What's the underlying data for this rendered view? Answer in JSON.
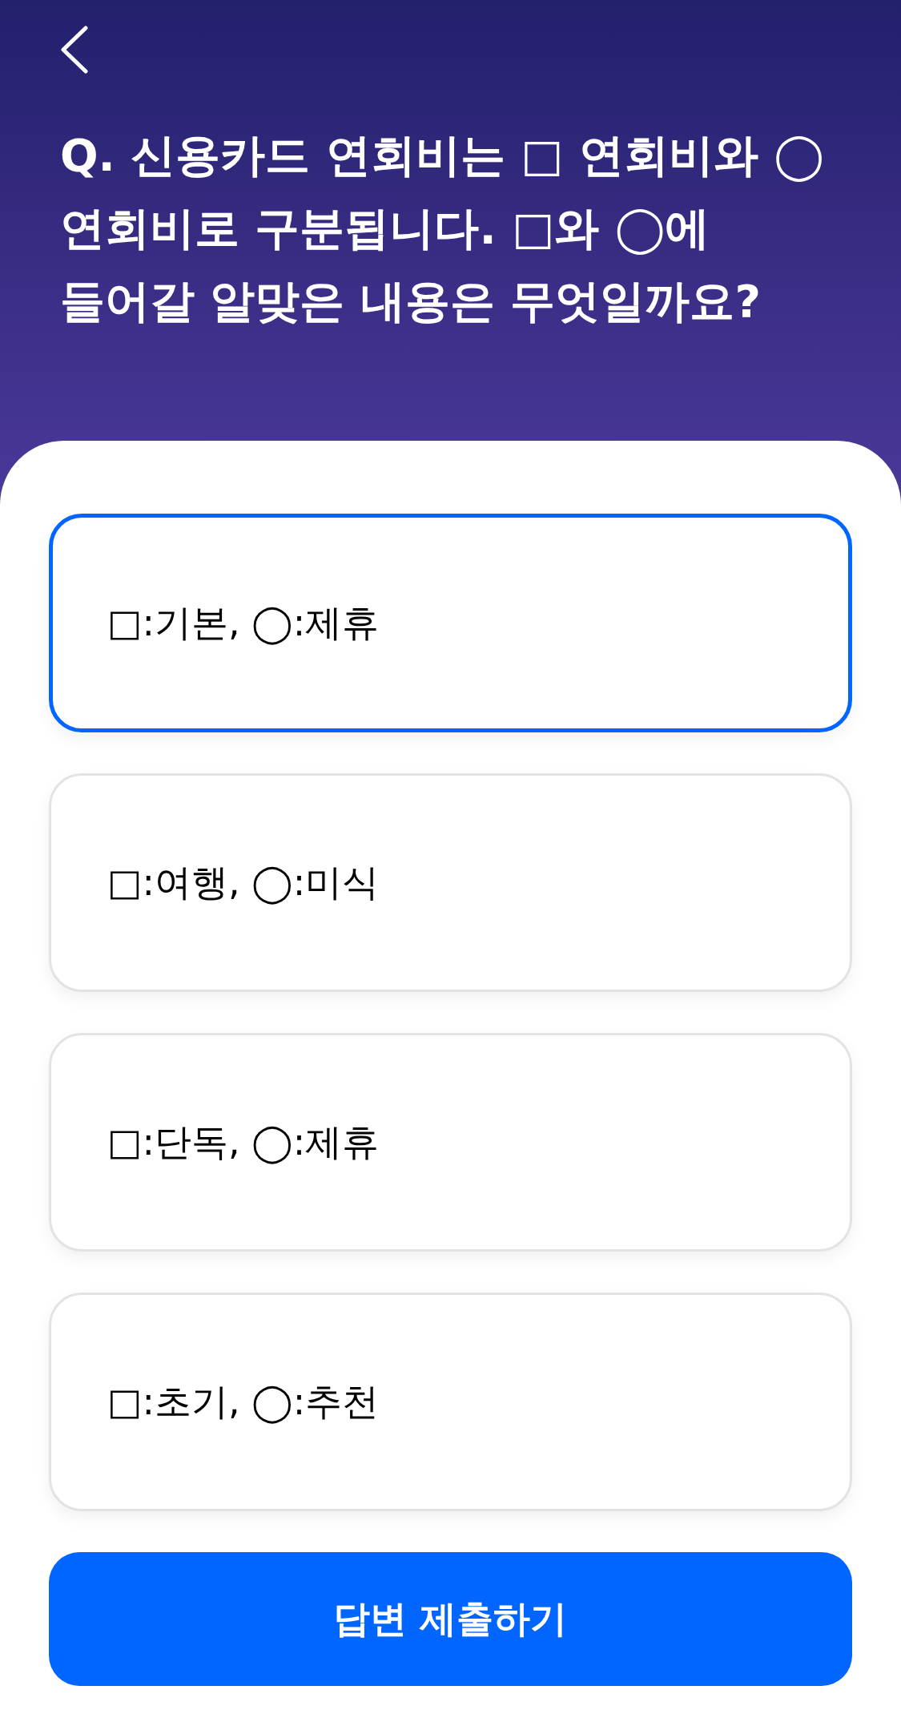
{
  "question": "Q. 신용카드 연회비는 □ 연회비와 ◯ 연회비로 구분됩니다. □와 ◯에 들어갈 알맞은 내용은 무엇일까요?",
  "options": [
    {
      "label": "□:기본, ◯:제휴",
      "selected": true
    },
    {
      "label": "□:여행, ◯:미식",
      "selected": false
    },
    {
      "label": "□:단독, ◯:제휴",
      "selected": false
    },
    {
      "label": "□:초기, ◯:추천",
      "selected": false
    }
  ],
  "submit_button": {
    "label": "답변 제출하기"
  }
}
